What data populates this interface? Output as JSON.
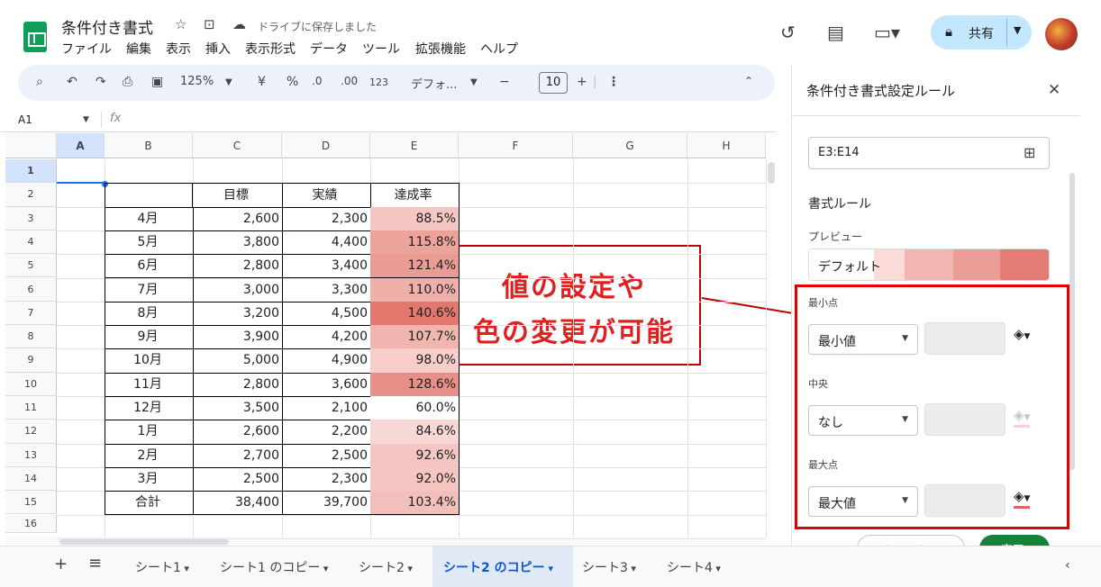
{
  "header": {
    "title": "条件付き書式",
    "star_icon": "☆",
    "move_icon": "⊡",
    "cloud_icon": "☁",
    "save_status": "ドライブに保存しました",
    "menus": [
      "ファイル",
      "編集",
      "表示",
      "挿入",
      "表示形式",
      "データ",
      "ツール",
      "拡張機能",
      "ヘルプ"
    ],
    "share_label": "共有"
  },
  "toolbar": {
    "zoom": "125%",
    "currency": "¥",
    "percent": "%",
    "dec_down": ".0",
    "dec_up": ".00",
    "num_format": "123",
    "font": "デフォ...",
    "font_size": "10",
    "minus": "−",
    "plus": "+"
  },
  "formula_bar": {
    "cell_ref": "A1",
    "fx": "fx"
  },
  "grid": {
    "columns": [
      "A",
      "B",
      "C",
      "D",
      "E",
      "F",
      "G",
      "H"
    ],
    "rows": [
      "1",
      "2",
      "3",
      "4",
      "5",
      "6",
      "7",
      "8",
      "9",
      "10",
      "11",
      "12",
      "13",
      "14",
      "15",
      "16"
    ],
    "table_header": [
      "目標",
      "実績",
      "達成率"
    ],
    "table_rows": [
      [
        "4月",
        "2,600",
        "2,300",
        "88.5%"
      ],
      [
        "5月",
        "3,800",
        "4,400",
        "115.8%"
      ],
      [
        "6月",
        "2,800",
        "3,400",
        "121.4%"
      ],
      [
        "7月",
        "3,000",
        "3,300",
        "110.0%"
      ],
      [
        "8月",
        "3,200",
        "4,500",
        "140.6%"
      ],
      [
        "9月",
        "3,900",
        "4,200",
        "107.7%"
      ],
      [
        "10月",
        "5,000",
        "4,900",
        "98.0%"
      ],
      [
        "11月",
        "2,800",
        "3,600",
        "128.6%"
      ],
      [
        "12月",
        "3,500",
        "2,100",
        "60.0%"
      ],
      [
        "1月",
        "2,600",
        "2,200",
        "84.6%"
      ],
      [
        "2月",
        "2,700",
        "2,500",
        "92.6%"
      ],
      [
        "3月",
        "2,500",
        "2,300",
        "92.0%"
      ],
      [
        "合計",
        "38,400",
        "39,700",
        "103.4%"
      ]
    ],
    "rate_colors": [
      "#f5c6c2",
      "#eca39c",
      "#ea9b93",
      "#f0b0aa",
      "#e2776d",
      "#f1b5af",
      "#f6cdc9",
      "#e88f87",
      "#ffffff",
      "#f8d8d5",
      "#f5c5c1",
      "#f5c6c2",
      "#f3bfba"
    ]
  },
  "callout": {
    "line1": "値の設定や",
    "line2": "色の変更が可能"
  },
  "panel": {
    "title": "条件付き書式設定ルール",
    "range": "E3:E14",
    "format_rules": "書式ルール",
    "preview_label": "プレビュー",
    "preview_text": "デフォルト",
    "min_label": "最小点",
    "min_value": "最小値",
    "mid_label": "中央",
    "mid_value": "なし",
    "max_label": "最大点",
    "max_value": "最大値",
    "cancel_label": "キャンセル",
    "done_label": "完了"
  },
  "tabs": [
    "シート1",
    "シート1 のコピー",
    "シート2",
    "シート2 のコピー",
    "シート3",
    "シート4"
  ],
  "active_tab": "シート2 のコピー"
}
